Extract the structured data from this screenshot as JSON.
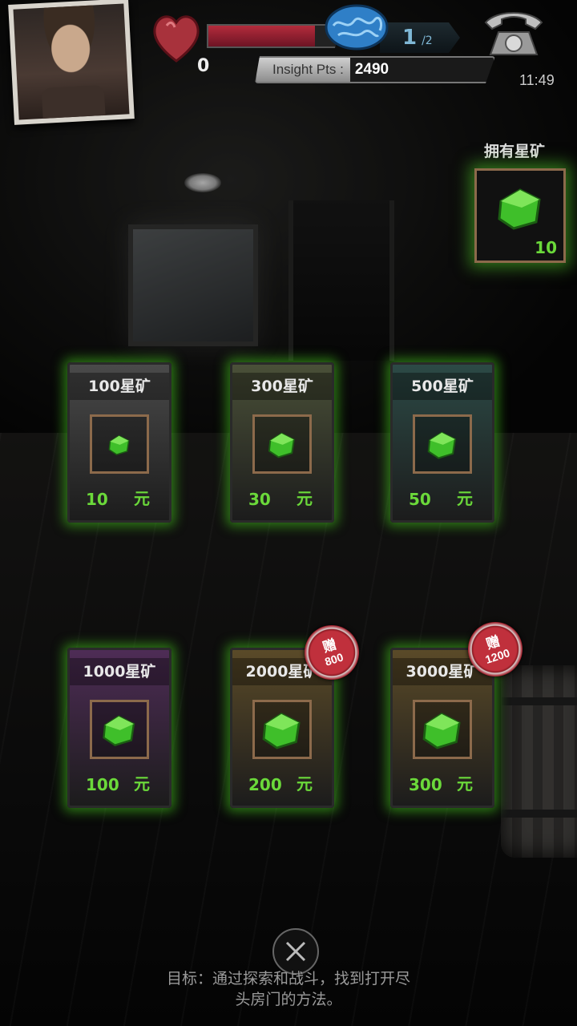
{
  "hud": {
    "hp_count": "0",
    "hp_fill_fraction": 0.8,
    "sanity_current": "1",
    "sanity_max": "/2",
    "insight_label": "Insight Pts :",
    "insight_value": "2490",
    "clock": "11:49",
    "icons": [
      "portrait",
      "heart-icon",
      "brain-icon",
      "telephone-icon"
    ]
  },
  "owned": {
    "title": "拥有星矿",
    "count": "10",
    "icon": "green-crystal-icon"
  },
  "store": {
    "items": [
      {
        "title": "100星矿",
        "price": "10",
        "unit": "元",
        "bonus": null,
        "bg": "#4a4a4a"
      },
      {
        "title": "300星矿",
        "price": "30",
        "unit": "元",
        "bonus": null,
        "bg": "#4a5038"
      },
      {
        "title": "500星矿",
        "price": "50",
        "unit": "元",
        "bonus": null,
        "bg": "#2c4a46"
      },
      {
        "title": "1000星矿",
        "price": "100",
        "unit": "元",
        "bonus": null,
        "bg": "#4e2c56"
      },
      {
        "title": "2000星矿",
        "price": "200",
        "unit": "元",
        "bonus": {
          "label": "赠",
          "amount": "800"
        },
        "bg": "#5a4a28"
      },
      {
        "title": "3000星矿",
        "price": "300",
        "unit": "元",
        "bonus": {
          "label": "赠",
          "amount": "1200"
        },
        "bg": "#5a4a28"
      }
    ]
  },
  "footer": {
    "objective_line1": "目标：通过探索和战斗，找到打开尽",
    "objective_line2": "头房门的方法。",
    "close_icon": "close-icon"
  },
  "colors": {
    "accent_green": "#6bd93a",
    "hp_red": "#b32c3c",
    "sanity_blue": "#7fb8d6",
    "bonus_red": "#c0303c"
  }
}
